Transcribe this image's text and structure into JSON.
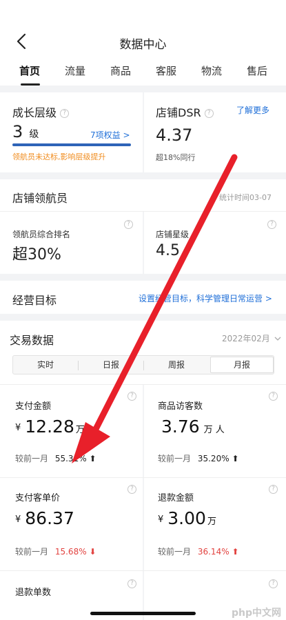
{
  "header": {
    "title": "数据中心"
  },
  "tabs": [
    {
      "label": "首页"
    },
    {
      "label": "流量"
    },
    {
      "label": "商品"
    },
    {
      "label": "客服"
    },
    {
      "label": "物流"
    },
    {
      "label": "售后"
    }
  ],
  "growth": {
    "title": "成长层级",
    "level": "3",
    "level_unit": "级",
    "rights": "7项权益 >",
    "warning": "领航员未达标,影响层级提升",
    "progress": 1.0
  },
  "dsr": {
    "title": "店铺DSR",
    "link": "了解更多",
    "value": "4.37",
    "note": "超18%同行"
  },
  "navigator": {
    "title": "店铺领航员",
    "stat_time": "统计时间03-07",
    "rank_label": "领航员综合排名",
    "rank_value": "超30%",
    "star_label": "店铺星级",
    "star_value": "4.5"
  },
  "goal": {
    "title": "经营目标",
    "link": "设置经营目标，科学管理日常运营 >"
  },
  "trade": {
    "title": "交易数据",
    "month": "2022年02月",
    "segments": [
      {
        "label": "实时"
      },
      {
        "label": "日报"
      },
      {
        "label": "周报"
      },
      {
        "label": "月报"
      }
    ],
    "metrics": {
      "pay_amount": {
        "label": "支付金额",
        "yen": "¥",
        "value": "12.28",
        "unit": "万",
        "cmp_label": "较前一月",
        "cmp_value": "55.31%",
        "arrow": "⬆"
      },
      "visitors": {
        "label": "商品访客数",
        "value": "3.76",
        "unit": "万 人",
        "cmp_label": "较前一月",
        "cmp_value": "35.20%",
        "arrow": "⬆"
      },
      "unit_price": {
        "label": "支付客单价",
        "yen": "¥",
        "value": "86.37",
        "cmp_label": "较前一月",
        "cmp_value": "15.68%",
        "arrow": "⬇"
      },
      "refund_amount": {
        "label": "退款金额",
        "yen": "¥",
        "value": "3.00",
        "unit": "万",
        "cmp_label": "较前一月",
        "cmp_value": "36.14%",
        "arrow": "⬆"
      },
      "refund_orders": {
        "label": "退款单数"
      }
    }
  },
  "colors": {
    "accent": "#1f6fd8",
    "warning": "#f08c1e",
    "down": "#e2423f",
    "annotation_arrow": "#e8202a"
  },
  "watermark": "php中文网"
}
